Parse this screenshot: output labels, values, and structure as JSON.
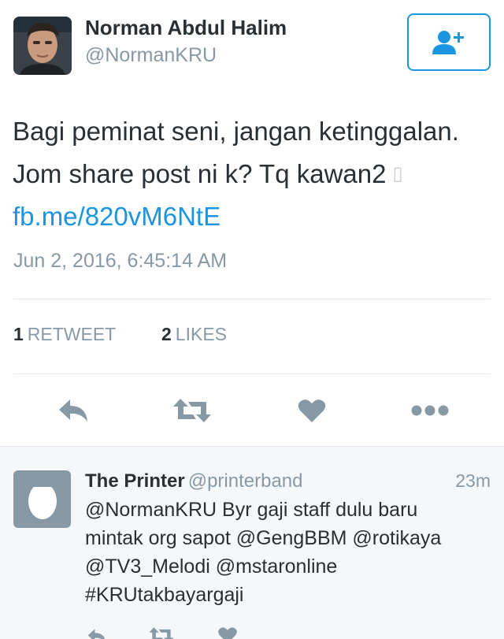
{
  "tweet": {
    "author_name": "Norman Abdul Halim",
    "author_handle": "@NormanKRU",
    "text_line1": "Bagi peminat seni, jangan ketinggalan.",
    "text_line2": "Jom share post ni k? Tq kawan2",
    "text_glyph": "▯",
    "link": "fb.me/820vM6NtE",
    "timestamp": "Jun 2, 2016, 6:45:14 AM",
    "retweet_count": "1",
    "retweet_label": "RETWEET",
    "like_count": "2",
    "like_label": "LIKES"
  },
  "reply": {
    "author_name": "The Printer",
    "author_handle": "@printerband",
    "time": "23m",
    "text_lines": [
      "@NormanKRU Byr gaji staff dulu baru",
      "mintak org sapot @GengBBM @rotikaya",
      "@TV3_Melodi @mstaronline",
      "#KRUtakbayargaji"
    ]
  },
  "icons": {
    "follow": "add-user-icon",
    "reply": "reply-icon",
    "retweet": "retweet-icon",
    "like": "heart-icon",
    "more": "more-icon",
    "avatar_placeholder": "egg-icon"
  },
  "colors": {
    "accent": "#1b95e0",
    "icon_gray": "#8899a6",
    "text": "#292f33",
    "reply_bg": "#f5f8fa"
  }
}
